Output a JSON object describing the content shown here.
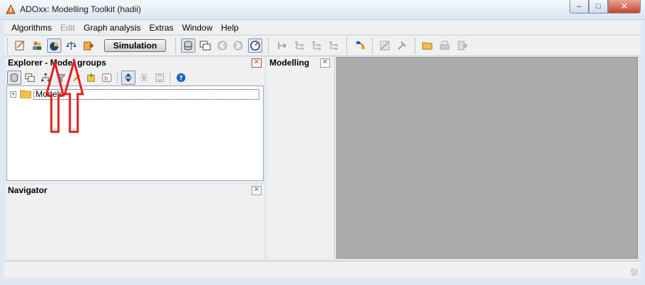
{
  "window": {
    "title": "ADOxx: Modelling Toolkit (hadii)",
    "controls": {
      "minimize": "–",
      "maximize": "□",
      "close": "✕"
    }
  },
  "menu": [
    {
      "label": "Algorithms",
      "enabled": true
    },
    {
      "label": "Edit",
      "enabled": false
    },
    {
      "label": "Graph analysis",
      "enabled": true
    },
    {
      "label": "Extras",
      "enabled": true
    },
    {
      "label": "Window",
      "enabled": true
    },
    {
      "label": "Help",
      "enabled": true
    }
  ],
  "toolbar": {
    "simulation_label": "Simulation",
    "icons": [
      "edit-model-icon",
      "users-icon",
      "model-analysis-icon",
      "comparison-icon",
      "export-icon",
      "model-db-icon",
      "windows-icon",
      "back-icon",
      "forward-icon",
      "navigate-icon",
      "flow-icon",
      "tree-icon",
      "tree-copy-icon",
      "tree-delete-icon",
      "graph-color-icon",
      "erase-icon",
      "tools-icon",
      "open-folder-icon",
      "print-icon",
      "exit-icon"
    ]
  },
  "explorer": {
    "title": "Explorer - Model groups",
    "tree": [
      {
        "label": "Models",
        "expanded": false
      }
    ]
  },
  "navigator": {
    "title": "Navigator"
  },
  "modelling": {
    "title": "Modelling"
  },
  "colors": {
    "workspace": "#ababab",
    "annotation": "#e02020",
    "accent": "#1f5fbf"
  }
}
